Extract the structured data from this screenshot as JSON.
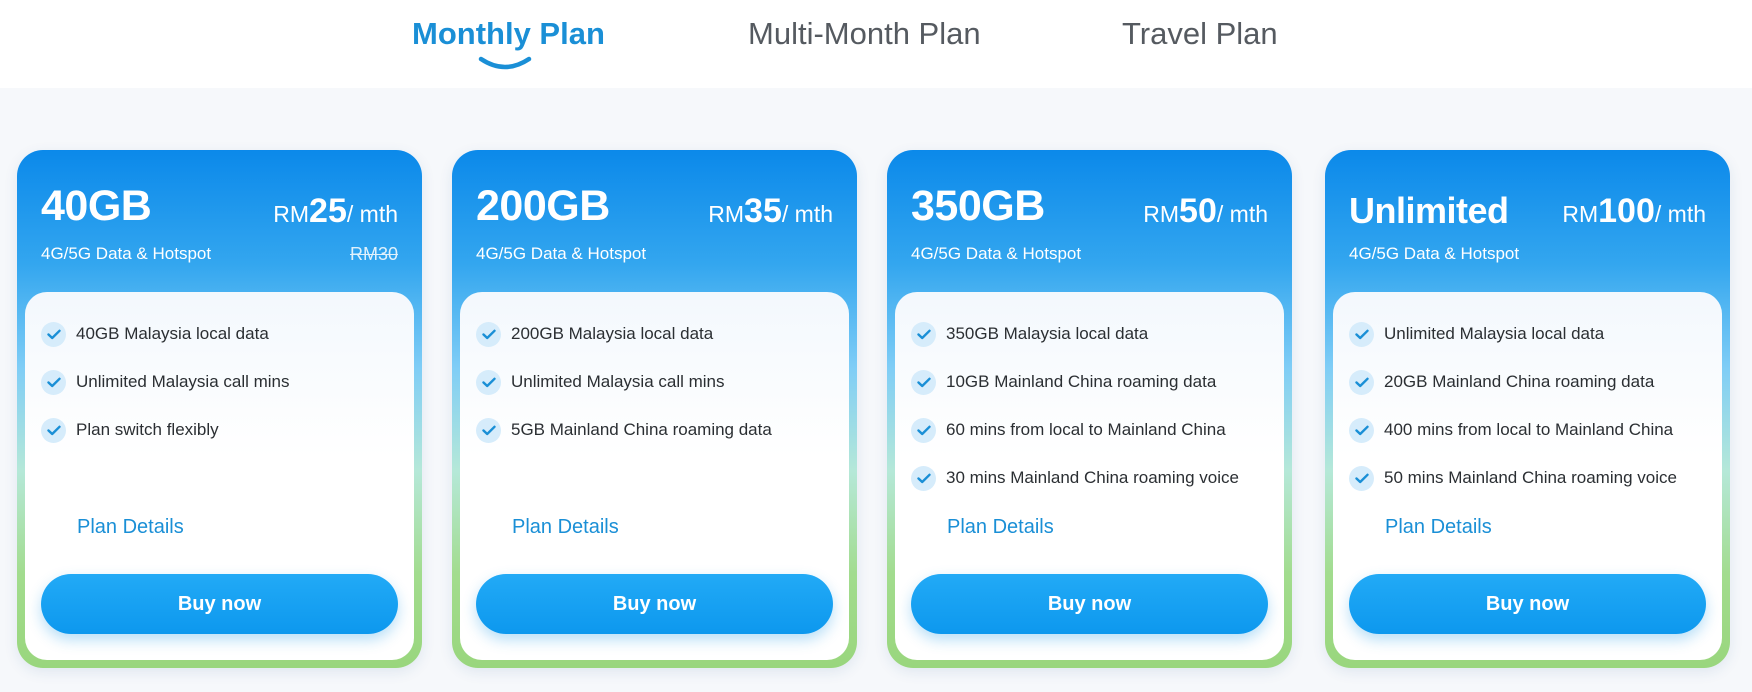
{
  "tabs": [
    {
      "label": "Monthly Plan",
      "active": true
    },
    {
      "label": "Multi-Month Plan",
      "active": false
    },
    {
      "label": "Travel Plan",
      "active": false
    }
  ],
  "colors": {
    "accent": "#1a8fd6",
    "card_top": "#0b89ea",
    "card_bottom": "#99d67d",
    "button": "#1aa3f4"
  },
  "plans": [
    {
      "amount": "40GB",
      "currency": "RM",
      "price": "25",
      "per": "/ mth",
      "subtitle": "4G/5G Data & Hotspot",
      "old_price": "RM30",
      "features": [
        "40GB Malaysia local data",
        "Unlimited Malaysia call mins",
        "Plan switch flexibly"
      ],
      "details_label": "Plan Details",
      "buy_label": "Buy now"
    },
    {
      "amount": "200GB",
      "currency": "RM",
      "price": "35",
      "per": "/ mth",
      "subtitle": "4G/5G Data & Hotspot",
      "features": [
        "200GB Malaysia local data",
        "Unlimited Malaysia call mins",
        "5GB Mainland China roaming data"
      ],
      "details_label": "Plan Details",
      "buy_label": "Buy now"
    },
    {
      "amount": "350GB",
      "currency": "RM",
      "price": "50",
      "per": "/ mth",
      "subtitle": "4G/5G Data & Hotspot",
      "features": [
        "350GB Malaysia local data",
        "10GB Mainland China roaming data",
        "60 mins from local to Mainland China",
        "30 mins Mainland China roaming voice"
      ],
      "details_label": "Plan Details",
      "buy_label": "Buy now"
    },
    {
      "amount": "Unlimited",
      "currency": "RM",
      "price": "100",
      "per": "/ mth",
      "subtitle": "4G/5G Data & Hotspot",
      "features": [
        "Unlimited Malaysia local data",
        "20GB Mainland China roaming data",
        "400 mins from local to Mainland China",
        "50 mins Mainland China roaming voice"
      ],
      "details_label": "Plan Details",
      "buy_label": "Buy now"
    }
  ]
}
